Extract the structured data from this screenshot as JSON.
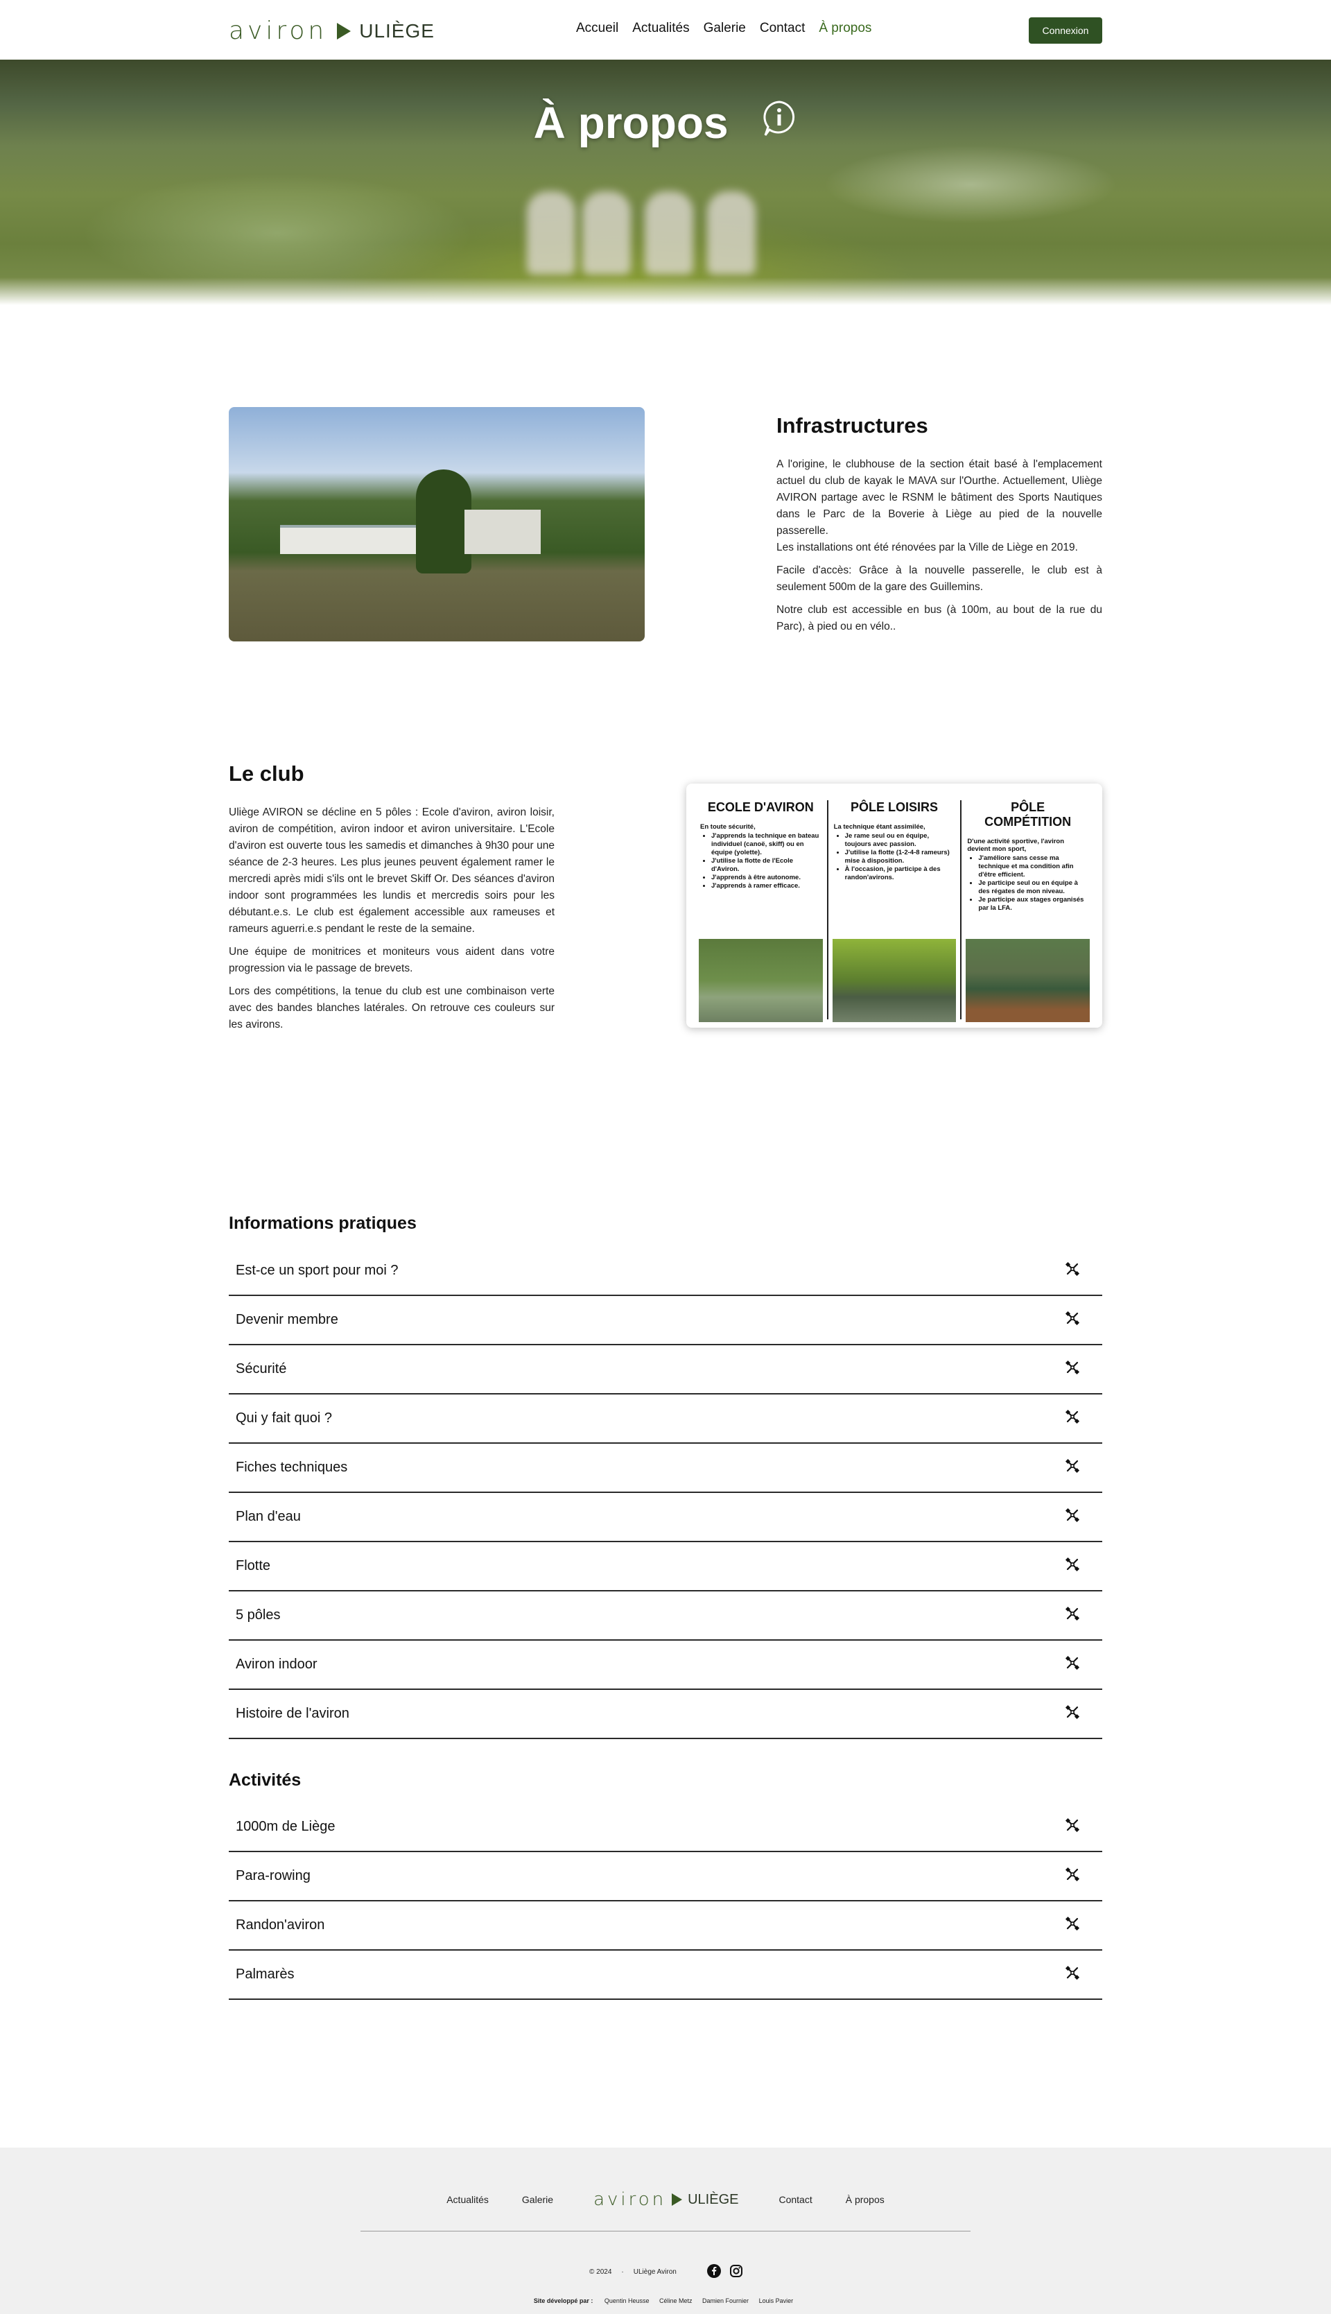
{
  "header": {
    "logo_word": "aviron",
    "logo_uni": "ULIÈGE",
    "nav": [
      "Accueil",
      "Actualités",
      "Galerie",
      "Contact",
      "À propos"
    ],
    "login": "Connexion"
  },
  "hero": {
    "title": "À propos",
    "icon": "info-icon"
  },
  "infrastructures": {
    "title": "Infrastructures",
    "paragraphs": [
      "A l'origine, le clubhouse de la section était basé à l'emplacement actuel du club de kayak le MAVA sur l'Ourthe. Actuellement, Uliège AVIRON partage avec le RSNM le bâtiment des Sports Nautiques dans le Parc de la Boverie à Liège au pied de la nouvelle passerelle.",
      "Les installations ont été rénovées par la Ville de Liège en 2019.",
      "Facile d'accès: Grâce à la nouvelle passerelle, le club est à seulement 500m de la gare des Guillemins.",
      "Notre club est accessible en bus (à 100m, au bout de la rue du Parc), à pied ou en vélo.."
    ]
  },
  "club": {
    "title": "Le club",
    "paragraphs": [
      "Uliège AVIRON se décline en 5 pôles : Ecole d'aviron, aviron loisir, aviron de compétition, aviron indoor et aviron universitaire. L'Ecole d'aviron est ouverte tous les samedis et dimanches à 9h30 pour une séance de 2-3 heures. Les plus jeunes peuvent également ramer le mercredi après midi s'ils ont le brevet Skiff Or. Des séances d'aviron indoor sont programmées les lundis et mercredis soirs pour les débutant.e.s. Le club est également accessible aux rameuses et rameurs aguerri.e.s pendant le reste de la semaine.",
      "Une équipe de monitrices et moniteurs vous aident dans votre progression via le passage de brevets.",
      "Lors des compétitions, la tenue du club est une combinaison verte avec des bandes blanches latérales. On retrouve ces couleurs sur les avirons."
    ],
    "poles": [
      {
        "title": "ECOLE D'AVIRON",
        "intro": "En toute sécurité,",
        "items": [
          "J'apprends la technique en bateau individuel (canoë, skiff) ou en équipe (yolette).",
          "J'utilise la flotte de l'Ecole d'Aviron.",
          "J'apprends à être autonome.",
          "J'apprends à ramer efficace."
        ]
      },
      {
        "title": "PÔLE LOISIRS",
        "intro": "La technique étant assimilée,",
        "items": [
          "Je rame seul ou en équipe, toujours avec passion.",
          "J'utilise la flotte (1-2-4-8 rameurs) mise à disposition.",
          "À l'occasion, je participe à des randon'avirons."
        ]
      },
      {
        "title": "PÔLE COMPÉTITION",
        "intro": "D'une activité sportive, l'aviron devient mon sport,",
        "items": [
          "J'améliore sans cesse ma technique et ma condition afin d'être efficient.",
          "Je participe seul ou en équipe à des régates de mon niveau.",
          "Je participe aux stages organisés par la LFA."
        ]
      }
    ]
  },
  "info": {
    "title": "Informations pratiques",
    "items": [
      "Est-ce un sport pour moi ?",
      "Devenir membre",
      "Sécurité",
      "Qui y fait quoi ?",
      "Fiches techniques",
      "Plan d'eau",
      "Flotte",
      "5 pôles",
      "Aviron indoor",
      "Histoire de l'aviron"
    ]
  },
  "activities": {
    "title": "Activités",
    "items": [
      "1000m de Liège",
      "Para-rowing",
      "Randon'aviron",
      "Palmarès"
    ]
  },
  "footer": {
    "nav_left": [
      "Actualités",
      "Galerie"
    ],
    "nav_right": [
      "Contact",
      "À propos"
    ],
    "logo_word": "aviron",
    "logo_uni": "ULIÈGE",
    "copyright": "© 2024",
    "sep": "·",
    "org": "ULiège Aviron",
    "dev_label": "Site développé par :",
    "devs": [
      "Quentin Heusse",
      "Céline Metz",
      "Damien Fournier",
      "Louis Pavier"
    ]
  },
  "colors": {
    "accent": "#2f5123",
    "active_nav": "#3a6a1e"
  }
}
